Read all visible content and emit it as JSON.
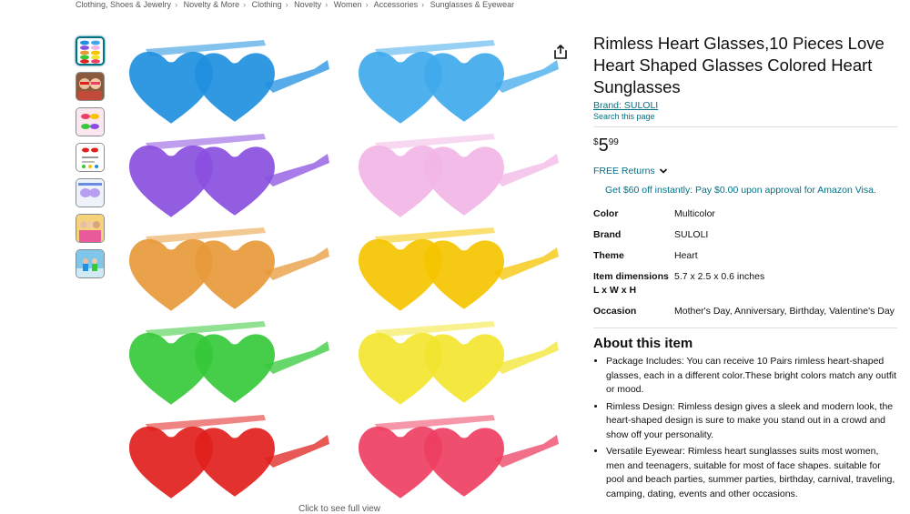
{
  "breadcrumb": [
    "Clothing, Shoes & Jewelry",
    "Novelty & More",
    "Clothing",
    "Novelty",
    "Women",
    "Accessories",
    "Sunglasses & Eyewear"
  ],
  "thumbnails": [
    "thumb-colors",
    "thumb-people",
    "thumb-accessories",
    "thumb-hearts",
    "thumb-closeup",
    "thumb-group",
    "thumb-outdoor"
  ],
  "image": {
    "click_to_full": "Click to see full view"
  },
  "product": {
    "title": "Rimless Heart Glasses,10 Pieces Love Heart Shaped Glasses Colored Heart Sunglasses",
    "brand_link": "Brand: SULOLI",
    "search_link": "Search this page",
    "price": {
      "symbol": "$",
      "whole": "5",
      "fraction": "99"
    },
    "returns": "FREE Returns",
    "promo": "Get $60 off instantly: Pay $0.00 upon approval for Amazon Visa."
  },
  "specs": [
    {
      "key": "Color",
      "value": "Multicolor"
    },
    {
      "key": "Brand",
      "value": "SULOLI"
    },
    {
      "key": "Theme",
      "value": "Heart"
    },
    {
      "key": "Item dimensions L x W x H",
      "value": "5.7 x 2.5 x 0.6 inches"
    },
    {
      "key": "Occasion",
      "value": "Mother's Day, Anniversary, Birthday, Valentine's Day"
    }
  ],
  "about": {
    "heading": "About this item",
    "bullets": [
      "Package Includes: You can receive 10 Pairs rimless heart-shaped glasses, each in a different color.These bright colors match any outfit or mood.",
      "Rimless Design: Rimless design gives a sleek and modern look, the heart-shaped design is sure to make you stand out in a crowd and show off your personality.",
      "Versatile Eyewear: Rimless heart sunglasses suits most women, men and teenagers, suitable for most of face shapes. suitable for pool and beach parties, summer parties, birthday, carnival, traveling, camping, dating, events and other occasions."
    ]
  },
  "glasses_colors": [
    "#1f8fe0",
    "#3fa9ec",
    "#8a4fe0",
    "#f2b6e6",
    "#e79a3a",
    "#f5c400",
    "#36c93a",
    "#f2e530",
    "#e0201c",
    "#ee3f62"
  ],
  "colors": {
    "link": "#007185",
    "text": "#0f1111",
    "muted": "#565959"
  }
}
